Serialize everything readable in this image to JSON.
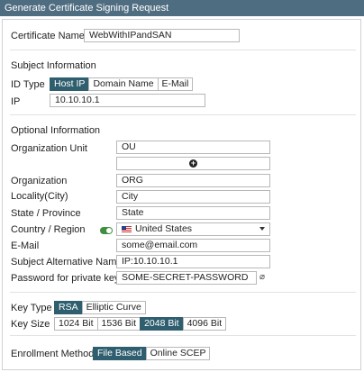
{
  "dialog": {
    "title": "Generate Certificate Signing Request"
  },
  "cert_name": {
    "label": "Certificate Name",
    "value": "WebWithIPandSAN"
  },
  "subject": {
    "heading": "Subject Information",
    "id_type_label": "ID Type",
    "id_type_options": [
      "Host IP",
      "Domain Name",
      "E-Mail"
    ],
    "id_type_selected": "Host IP",
    "ip_label": "IP",
    "ip_value": "10.10.10.1"
  },
  "optional": {
    "heading": "Optional Information",
    "org_unit_label": "Organization Unit",
    "org_unit_value": "OU",
    "org_unit_add_icon": "plus-circle-icon",
    "organization_label": "Organization",
    "organization_value": "ORG",
    "locality_label": "Locality(City)",
    "locality_value": "City",
    "state_label": "State / Province",
    "state_value": "State",
    "country_label": "Country / Region",
    "country_value": "United States",
    "email_label": "E-Mail",
    "email_value": "some@email.com",
    "san_label": "Subject Alternative Name",
    "san_value": "IP:10.10.10.1",
    "password_label": "Password for private key",
    "password_value": "SOME-SECRET-PASSWORD"
  },
  "key": {
    "type_label": "Key Type",
    "type_options": [
      "RSA",
      "Elliptic Curve"
    ],
    "type_selected": "RSA",
    "size_label": "Key Size",
    "size_options": [
      "1024 Bit",
      "1536 Bit",
      "2048 Bit",
      "4096 Bit"
    ],
    "size_selected": "2048 Bit"
  },
  "enrollment": {
    "label": "Enrollment Method",
    "options": [
      "File Based",
      "Online SCEP"
    ],
    "selected": "File Based"
  },
  "colors": {
    "header": "#4f6d80",
    "selected": "#2f5f6f",
    "toggle": "#3f8f3f"
  }
}
